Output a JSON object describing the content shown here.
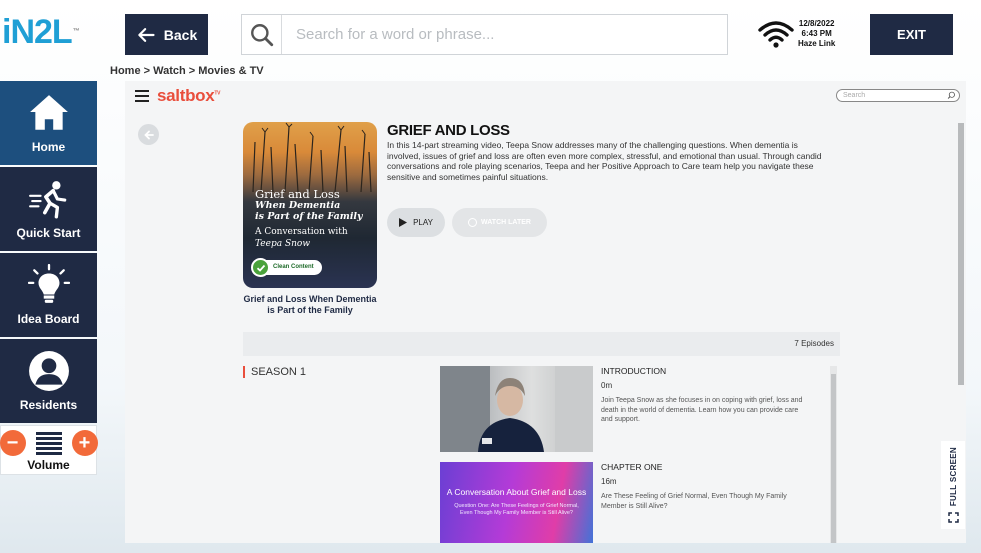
{
  "header": {
    "logo_text": "iN2L",
    "back_label": "Back",
    "search_placeholder": "Search for a word or phrase...",
    "date": "12/8/2022",
    "time": "6:43 PM",
    "network": "Haze Link",
    "exit_label": "EXIT"
  },
  "breadcrumb": "Home > Watch > Movies & TV",
  "sidebar": {
    "items": [
      {
        "label": "Home",
        "icon": "home-icon"
      },
      {
        "label": "Quick Start",
        "icon": "running-person-icon"
      },
      {
        "label": "Idea Board",
        "icon": "lightbulb-icon"
      },
      {
        "label": "Residents",
        "icon": "person-icon"
      }
    ],
    "volume_label": "Volume"
  },
  "app": {
    "brand": "saltbox",
    "brand_mark": "TV",
    "search_placeholder": "Search",
    "poster": {
      "title_line1": "Grief and Loss",
      "title_line2": "When Dementia",
      "title_line3": "is Part of the Family",
      "subtitle": "A Conversation with",
      "presenter": "Teepa Snow",
      "badge": "Clean Content"
    },
    "caption": "Grief and Loss When Dementia is Part of the Family",
    "title": "GRIEF AND LOSS",
    "description": "In this 14-part streaming video, Teepa Snow addresses many of the challenging questions. When dementia is involved, issues of grief and loss are often even more complex, stressful, and emotional than usual. Through candid conversations and role playing scenarios, Teepa and her Positive Approach to Care team help you navigate these sensitive and sometimes painful situations.",
    "play_label": "PLAY",
    "watch_later_label": "WATCH LATER",
    "episodes_count": "7 Episodes",
    "season_label": "SEASON 1",
    "episodes": [
      {
        "title": "INTRODUCTION",
        "duration": "0m",
        "summary": "Join Teepa Snow as she focuses in on coping with grief, loss and death in the world of dementia. Learn how you can provide care and support."
      },
      {
        "title": "CHAPTER ONE",
        "duration": "16m",
        "summary": "Are These Feeling of Grief Normal, Even Though My Family Member is Still Alive?",
        "thumb_title": "A Conversation About Grief and Loss",
        "thumb_sub": "Question One: Are These Feelings of Grief Normal, Even Though My Family Member is Still Alive?"
      }
    ],
    "fullscreen_label": "FULL SCREEN"
  },
  "colors": {
    "navy": "#1f2a44",
    "active_blue": "#1d4f7e",
    "brand_red": "#e94e3c",
    "volume_orange": "#f26a3a"
  }
}
